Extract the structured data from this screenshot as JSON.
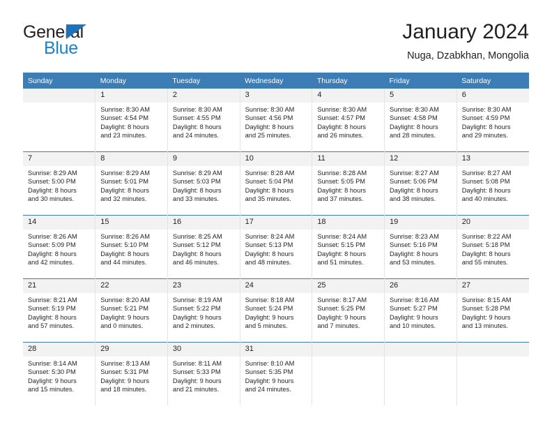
{
  "brand": {
    "name_part1": "General",
    "name_part2": "Blue",
    "accent_color": "#1b81cd",
    "triangle_color": "#1b74bb"
  },
  "header": {
    "title": "January 2024",
    "subtitle": "Nuga, Dzabkhan, Mongolia"
  },
  "theme": {
    "header_row_color": "#3c7db5",
    "daynum_band_color": "#f2f2f2",
    "text_color": "#231f20"
  },
  "weekdays": [
    "Sunday",
    "Monday",
    "Tuesday",
    "Wednesday",
    "Thursday",
    "Friday",
    "Saturday"
  ],
  "weeks": [
    [
      {
        "day": "",
        "sunrise": "",
        "sunset": "",
        "daylight1": "",
        "daylight2": ""
      },
      {
        "day": "1",
        "sunrise": "Sunrise: 8:30 AM",
        "sunset": "Sunset: 4:54 PM",
        "daylight1": "Daylight: 8 hours",
        "daylight2": "and 23 minutes."
      },
      {
        "day": "2",
        "sunrise": "Sunrise: 8:30 AM",
        "sunset": "Sunset: 4:55 PM",
        "daylight1": "Daylight: 8 hours",
        "daylight2": "and 24 minutes."
      },
      {
        "day": "3",
        "sunrise": "Sunrise: 8:30 AM",
        "sunset": "Sunset: 4:56 PM",
        "daylight1": "Daylight: 8 hours",
        "daylight2": "and 25 minutes."
      },
      {
        "day": "4",
        "sunrise": "Sunrise: 8:30 AM",
        "sunset": "Sunset: 4:57 PM",
        "daylight1": "Daylight: 8 hours",
        "daylight2": "and 26 minutes."
      },
      {
        "day": "5",
        "sunrise": "Sunrise: 8:30 AM",
        "sunset": "Sunset: 4:58 PM",
        "daylight1": "Daylight: 8 hours",
        "daylight2": "and 28 minutes."
      },
      {
        "day": "6",
        "sunrise": "Sunrise: 8:30 AM",
        "sunset": "Sunset: 4:59 PM",
        "daylight1": "Daylight: 8 hours",
        "daylight2": "and 29 minutes."
      }
    ],
    [
      {
        "day": "7",
        "sunrise": "Sunrise: 8:29 AM",
        "sunset": "Sunset: 5:00 PM",
        "daylight1": "Daylight: 8 hours",
        "daylight2": "and 30 minutes."
      },
      {
        "day": "8",
        "sunrise": "Sunrise: 8:29 AM",
        "sunset": "Sunset: 5:01 PM",
        "daylight1": "Daylight: 8 hours",
        "daylight2": "and 32 minutes."
      },
      {
        "day": "9",
        "sunrise": "Sunrise: 8:29 AM",
        "sunset": "Sunset: 5:03 PM",
        "daylight1": "Daylight: 8 hours",
        "daylight2": "and 33 minutes."
      },
      {
        "day": "10",
        "sunrise": "Sunrise: 8:28 AM",
        "sunset": "Sunset: 5:04 PM",
        "daylight1": "Daylight: 8 hours",
        "daylight2": "and 35 minutes."
      },
      {
        "day": "11",
        "sunrise": "Sunrise: 8:28 AM",
        "sunset": "Sunset: 5:05 PM",
        "daylight1": "Daylight: 8 hours",
        "daylight2": "and 37 minutes."
      },
      {
        "day": "12",
        "sunrise": "Sunrise: 8:27 AM",
        "sunset": "Sunset: 5:06 PM",
        "daylight1": "Daylight: 8 hours",
        "daylight2": "and 38 minutes."
      },
      {
        "day": "13",
        "sunrise": "Sunrise: 8:27 AM",
        "sunset": "Sunset: 5:08 PM",
        "daylight1": "Daylight: 8 hours",
        "daylight2": "and 40 minutes."
      }
    ],
    [
      {
        "day": "14",
        "sunrise": "Sunrise: 8:26 AM",
        "sunset": "Sunset: 5:09 PM",
        "daylight1": "Daylight: 8 hours",
        "daylight2": "and 42 minutes."
      },
      {
        "day": "15",
        "sunrise": "Sunrise: 8:26 AM",
        "sunset": "Sunset: 5:10 PM",
        "daylight1": "Daylight: 8 hours",
        "daylight2": "and 44 minutes."
      },
      {
        "day": "16",
        "sunrise": "Sunrise: 8:25 AM",
        "sunset": "Sunset: 5:12 PM",
        "daylight1": "Daylight: 8 hours",
        "daylight2": "and 46 minutes."
      },
      {
        "day": "17",
        "sunrise": "Sunrise: 8:24 AM",
        "sunset": "Sunset: 5:13 PM",
        "daylight1": "Daylight: 8 hours",
        "daylight2": "and 48 minutes."
      },
      {
        "day": "18",
        "sunrise": "Sunrise: 8:24 AM",
        "sunset": "Sunset: 5:15 PM",
        "daylight1": "Daylight: 8 hours",
        "daylight2": "and 51 minutes."
      },
      {
        "day": "19",
        "sunrise": "Sunrise: 8:23 AM",
        "sunset": "Sunset: 5:16 PM",
        "daylight1": "Daylight: 8 hours",
        "daylight2": "and 53 minutes."
      },
      {
        "day": "20",
        "sunrise": "Sunrise: 8:22 AM",
        "sunset": "Sunset: 5:18 PM",
        "daylight1": "Daylight: 8 hours",
        "daylight2": "and 55 minutes."
      }
    ],
    [
      {
        "day": "21",
        "sunrise": "Sunrise: 8:21 AM",
        "sunset": "Sunset: 5:19 PM",
        "daylight1": "Daylight: 8 hours",
        "daylight2": "and 57 minutes."
      },
      {
        "day": "22",
        "sunrise": "Sunrise: 8:20 AM",
        "sunset": "Sunset: 5:21 PM",
        "daylight1": "Daylight: 9 hours",
        "daylight2": "and 0 minutes."
      },
      {
        "day": "23",
        "sunrise": "Sunrise: 8:19 AM",
        "sunset": "Sunset: 5:22 PM",
        "daylight1": "Daylight: 9 hours",
        "daylight2": "and 2 minutes."
      },
      {
        "day": "24",
        "sunrise": "Sunrise: 8:18 AM",
        "sunset": "Sunset: 5:24 PM",
        "daylight1": "Daylight: 9 hours",
        "daylight2": "and 5 minutes."
      },
      {
        "day": "25",
        "sunrise": "Sunrise: 8:17 AM",
        "sunset": "Sunset: 5:25 PM",
        "daylight1": "Daylight: 9 hours",
        "daylight2": "and 7 minutes."
      },
      {
        "day": "26",
        "sunrise": "Sunrise: 8:16 AM",
        "sunset": "Sunset: 5:27 PM",
        "daylight1": "Daylight: 9 hours",
        "daylight2": "and 10 minutes."
      },
      {
        "day": "27",
        "sunrise": "Sunrise: 8:15 AM",
        "sunset": "Sunset: 5:28 PM",
        "daylight1": "Daylight: 9 hours",
        "daylight2": "and 13 minutes."
      }
    ],
    [
      {
        "day": "28",
        "sunrise": "Sunrise: 8:14 AM",
        "sunset": "Sunset: 5:30 PM",
        "daylight1": "Daylight: 9 hours",
        "daylight2": "and 15 minutes."
      },
      {
        "day": "29",
        "sunrise": "Sunrise: 8:13 AM",
        "sunset": "Sunset: 5:31 PM",
        "daylight1": "Daylight: 9 hours",
        "daylight2": "and 18 minutes."
      },
      {
        "day": "30",
        "sunrise": "Sunrise: 8:11 AM",
        "sunset": "Sunset: 5:33 PM",
        "daylight1": "Daylight: 9 hours",
        "daylight2": "and 21 minutes."
      },
      {
        "day": "31",
        "sunrise": "Sunrise: 8:10 AM",
        "sunset": "Sunset: 5:35 PM",
        "daylight1": "Daylight: 9 hours",
        "daylight2": "and 24 minutes."
      },
      {
        "day": "",
        "sunrise": "",
        "sunset": "",
        "daylight1": "",
        "daylight2": ""
      },
      {
        "day": "",
        "sunrise": "",
        "sunset": "",
        "daylight1": "",
        "daylight2": ""
      },
      {
        "day": "",
        "sunrise": "",
        "sunset": "",
        "daylight1": "",
        "daylight2": ""
      }
    ]
  ]
}
